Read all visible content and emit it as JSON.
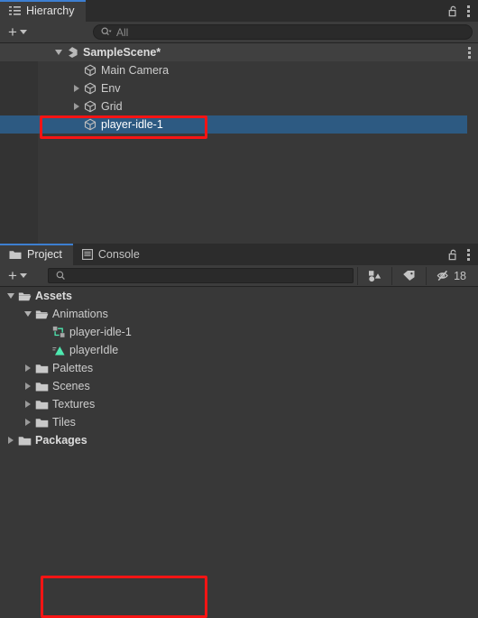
{
  "theme": {
    "accent": "#3d7fd1",
    "selection_blue": "#2d5a82",
    "annotation_red": "#f71414",
    "panel_bg": "#383838",
    "tabbar_bg": "#2c2c2c",
    "teal": "#4ee8b0"
  },
  "hierarchy": {
    "tab": {
      "label": "Hierarchy",
      "icon": "hierarchy-list-icon",
      "active": true
    },
    "lock_icon": "lock-open-icon",
    "menu_icon": "kebab-menu-icon",
    "toolbar": {
      "add_label": "+",
      "add_icon": "plus-icon",
      "dropdown_icon": "chevron-down-icon",
      "search": {
        "placeholder": "All",
        "value": "",
        "icon": "search-dropdown-icon"
      }
    },
    "rows": [
      {
        "label": "SampleScene*",
        "icon": "unity-scene-icon",
        "depth": 1,
        "expander": "down",
        "bold": true,
        "selected": false,
        "kebab": true
      },
      {
        "label": "Main Camera",
        "icon": "gameobject-cube-icon",
        "depth": 2,
        "expander": "none",
        "bold": false,
        "selected": false,
        "kebab": false
      },
      {
        "label": "Env",
        "icon": "gameobject-cube-icon",
        "depth": 2,
        "expander": "right",
        "bold": false,
        "selected": false,
        "kebab": false
      },
      {
        "label": "Grid",
        "icon": "gameobject-cube-icon",
        "depth": 2,
        "expander": "right",
        "bold": false,
        "selected": false,
        "kebab": false
      },
      {
        "label": "player-idle-1",
        "icon": "gameobject-cube-icon",
        "depth": 2,
        "expander": "none",
        "bold": false,
        "selected": true,
        "kebab": false
      }
    ]
  },
  "project": {
    "tabs": [
      {
        "label": "Project",
        "icon": "folder-icon",
        "active": true
      },
      {
        "label": "Console",
        "icon": "console-icon",
        "active": false
      }
    ],
    "lock_icon": "lock-open-icon",
    "menu_icon": "kebab-menu-icon",
    "toolbar": {
      "add_label": "+",
      "add_icon": "plus-icon",
      "dropdown_icon": "chevron-down-icon",
      "search": {
        "placeholder": "",
        "value": "",
        "icon": "search-icon"
      },
      "filter_type_icon": "filter-by-type-icon",
      "filter_label_icon": "filter-by-label-icon",
      "hidden_packages_icon": "eye-slash-icon",
      "hidden_packages_count": "18"
    },
    "rows": [
      {
        "label": "Assets",
        "icon": "folder-open-icon",
        "depth": 0,
        "expander": "down",
        "bold": true,
        "highlight": false
      },
      {
        "label": "Animations",
        "icon": "folder-open-icon",
        "depth": 1,
        "expander": "down",
        "bold": false,
        "highlight": false
      },
      {
        "label": "player-idle-1",
        "icon": "animator-controller-icon",
        "depth": 2,
        "expander": "none",
        "bold": false,
        "highlight": true
      },
      {
        "label": "playerIdle",
        "icon": "animation-clip-icon",
        "depth": 2,
        "expander": "none",
        "bold": false,
        "highlight": true
      },
      {
        "label": "Palettes",
        "icon": "folder-icon",
        "depth": 1,
        "expander": "right",
        "bold": false,
        "highlight": false
      },
      {
        "label": "Scenes",
        "icon": "folder-icon",
        "depth": 1,
        "expander": "right",
        "bold": false,
        "highlight": false
      },
      {
        "label": "Textures",
        "icon": "folder-icon",
        "depth": 1,
        "expander": "right",
        "bold": false,
        "highlight": false
      },
      {
        "label": "Tiles",
        "icon": "folder-icon",
        "depth": 1,
        "expander": "right",
        "bold": false,
        "highlight": false
      },
      {
        "label": "Packages",
        "icon": "folder-icon",
        "depth": 0,
        "expander": "right",
        "bold": true,
        "highlight": false
      }
    ]
  }
}
